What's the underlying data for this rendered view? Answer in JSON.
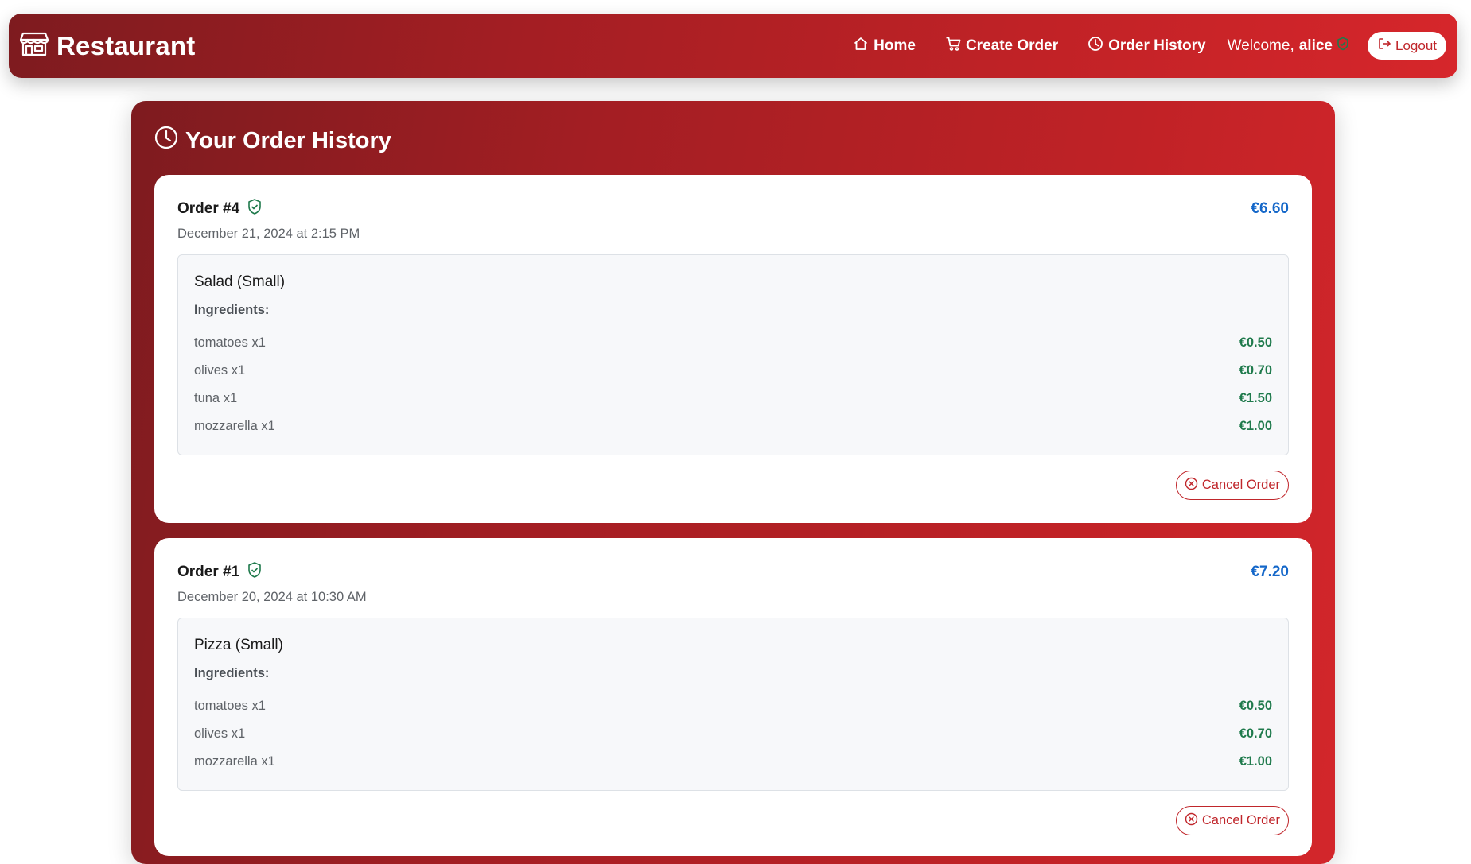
{
  "navbar": {
    "brand": "Restaurant",
    "brand_icon": "shop-icon",
    "links": [
      {
        "label": "Home",
        "icon": "house-icon"
      },
      {
        "label": "Create Order",
        "icon": "cart-icon"
      },
      {
        "label": "Order History",
        "icon": "clock-icon"
      }
    ],
    "welcome_prefix": "Welcome,",
    "username": "alice",
    "logout_label": "Logout"
  },
  "page": {
    "title": "Your Order History",
    "title_icon": "clock-icon"
  },
  "orders": [
    {
      "title": "Order #4",
      "date": "December 21, 2024 at 2:15 PM",
      "total": "€6.60",
      "item_name": "Salad (Small)",
      "ingredients_label": "Ingredients:",
      "ingredients": [
        {
          "name": "tomatoes x1",
          "price": "€0.50"
        },
        {
          "name": "olives x1",
          "price": "€0.70"
        },
        {
          "name": "tuna x1",
          "price": "€1.50"
        },
        {
          "name": "mozzarella x1",
          "price": "€1.00"
        }
      ],
      "cancel_label": "Cancel Order"
    },
    {
      "title": "Order #1",
      "date": "December 20, 2024 at 10:30 AM",
      "total": "€7.20",
      "item_name": "Pizza (Small)",
      "ingredients_label": "Ingredients:",
      "ingredients": [
        {
          "name": "tomatoes x1",
          "price": "€0.50"
        },
        {
          "name": "olives x1",
          "price": "€0.70"
        },
        {
          "name": "mozzarella x1",
          "price": "€1.00"
        }
      ],
      "cancel_label": "Cancel Order"
    }
  ],
  "colors": {
    "brand_red": "#c0262b",
    "total_blue": "#1467c9",
    "price_green": "#1f7a4c",
    "verified_green": "#1f7a4c"
  }
}
